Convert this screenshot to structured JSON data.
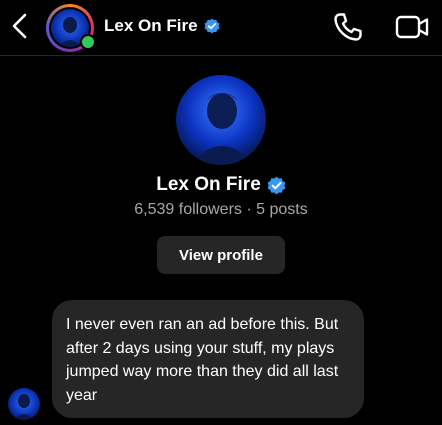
{
  "header": {
    "contact_name": "Lex On Fire",
    "verified": true,
    "online": true,
    "icons": {
      "back": "back-chevron-icon",
      "call": "phone-icon",
      "video": "video-camera-icon",
      "verified": "verified-badge-icon"
    }
  },
  "profile": {
    "name": "Lex On Fire",
    "stats": "6,539 followers · 5 posts",
    "view_profile_label": "View profile"
  },
  "messages": [
    {
      "sender": "Lex On Fire",
      "text": "I never even ran an ad before this. But after 2 days using your stuff, my plays jumped way more than they did all last year"
    }
  ],
  "colors": {
    "background": "#000000",
    "bubble": "#262626",
    "secondary_text": "#a8a8a8",
    "verified_blue": "#3897f0",
    "online_green": "#35c759"
  }
}
